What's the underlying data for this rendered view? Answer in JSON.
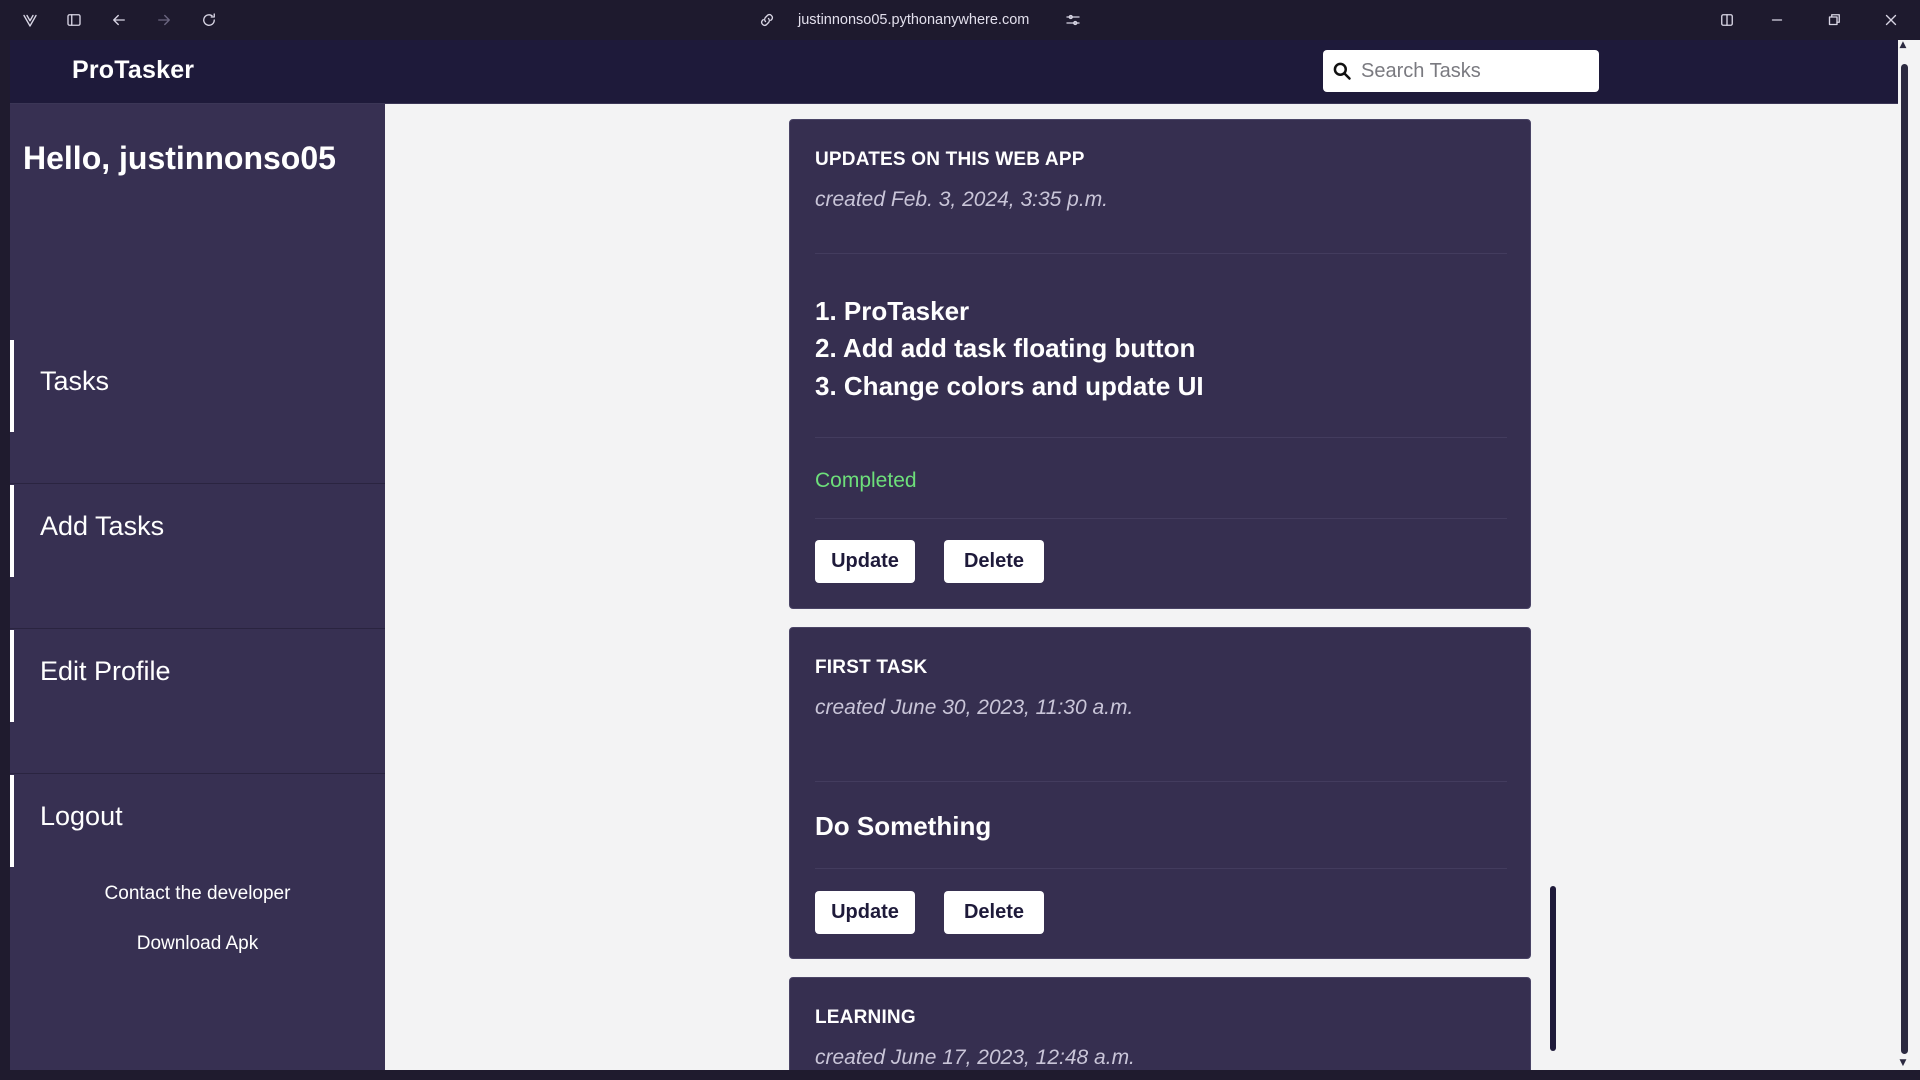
{
  "browser": {
    "url": "justinnonso05.pythonanywhere.com"
  },
  "nav": {
    "brand": "ProTasker",
    "search_placeholder": "Search Tasks"
  },
  "sidebar": {
    "greeting": "Hello, justinnonso05",
    "items": [
      {
        "label": "Tasks"
      },
      {
        "label": "Add Tasks"
      },
      {
        "label": "Edit Profile"
      },
      {
        "label": "Logout"
      }
    ],
    "links": [
      {
        "label": "Contact the developer"
      },
      {
        "label": "Download Apk"
      }
    ]
  },
  "tasks": [
    {
      "title": "UPDATES ON THIS WEB APP",
      "created": "created Feb. 3, 2024, 3:35 p.m.",
      "body": [
        "1. ProTasker",
        "2. Add add task floating button",
        "3. Change colors and update UI"
      ],
      "status": "Completed",
      "update_label": "Update",
      "delete_label": "Delete"
    },
    {
      "title": "FIRST TASK",
      "created": "created June 30, 2023, 11:30 a.m.",
      "body": [
        "Do Something"
      ],
      "update_label": "Update",
      "delete_label": "Delete"
    },
    {
      "title": "LEARNING",
      "created": "created June 17, 2023, 12:48 a.m."
    }
  ],
  "colors": {
    "nav_bg": "#1e1a3a",
    "sidebar_bg": "#373052",
    "card_bg": "#362f50",
    "status_completed": "#6ddf7a",
    "page_bg": "#f3f3f4"
  }
}
